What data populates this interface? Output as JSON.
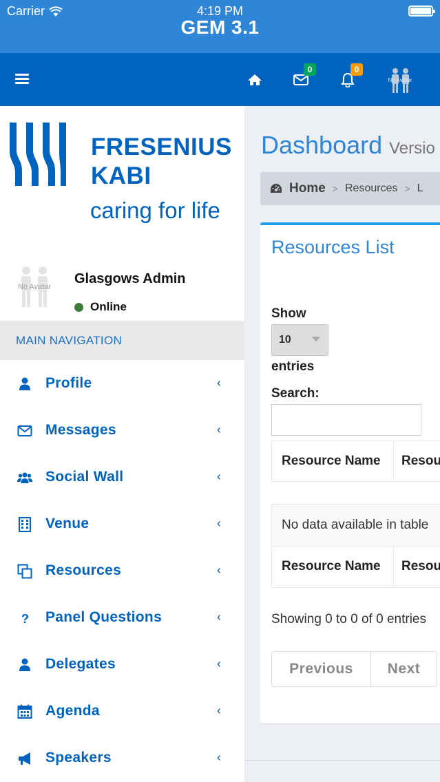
{
  "status_bar": {
    "carrier": "Carrier",
    "time": "4:19 PM"
  },
  "app": {
    "title": "GEM 3.1"
  },
  "navbar": {
    "icons": [
      "menu-icon",
      "home-icon",
      "envelope-icon",
      "bell-icon",
      "user-avatar-icon"
    ],
    "messages_badge": "0",
    "notifications_badge": "0",
    "avatar_text": "No Avatar",
    "colors": {
      "navbar": "#0063be",
      "messages_badge": "#00a65a",
      "notifications_badge": "#f39c12"
    }
  },
  "sidebar": {
    "brand_line1": "FRESENIUS",
    "brand_line2": "KABI",
    "brand_tagline": "caring for life",
    "user": {
      "avatar_text": "No Avatar",
      "name": "Glasgows Admin",
      "status": "Online"
    },
    "nav_header": "MAIN NAVIGATION",
    "items": [
      {
        "label": "Profile",
        "icon": "user-icon"
      },
      {
        "label": "Messages",
        "icon": "envelope-icon"
      },
      {
        "label": "Social Wall",
        "icon": "users-icon"
      },
      {
        "label": "Venue",
        "icon": "building-icon"
      },
      {
        "label": "Resources",
        "icon": "copy-icon"
      },
      {
        "label": "Panel Questions",
        "icon": "question-icon"
      },
      {
        "label": "Delegates",
        "icon": "user-icon"
      },
      {
        "label": "Agenda",
        "icon": "calendar-icon"
      },
      {
        "label": "Speakers",
        "icon": "bullhorn-icon"
      }
    ]
  },
  "content": {
    "title": "Dashboard",
    "subtitle": "Versio",
    "breadcrumb": [
      "Home",
      "Resources",
      "L"
    ],
    "box": {
      "title": "Resources List",
      "show_label": "Show",
      "page_size": "10",
      "entries_label": "entries",
      "search_label": "Search:",
      "search_value": "",
      "columns": [
        "Resource Name",
        "Resou"
      ],
      "empty_message": "No data available in table",
      "info": "Showing 0 to 0 of 0 entries",
      "pager": {
        "previous": "Previous",
        "next": "Next"
      }
    }
  }
}
